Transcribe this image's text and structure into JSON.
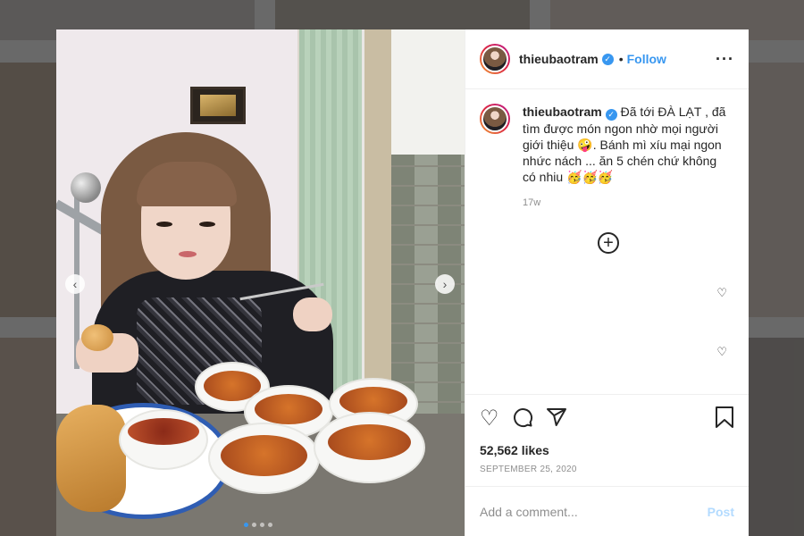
{
  "post": {
    "username": "thieubaotram",
    "verified_glyph": "✓",
    "separator": "•",
    "follow_label": "Follow",
    "more_icon": "···",
    "caption": "Đã tới ĐÀ LẠT , đã tìm được món ngon nhờ mọi người giới thiệu 🤪. Bánh mì xíu mại ngon nhức nách ... ăn 5 chén chứ không có nhiu 🥳🥳🥳",
    "time_ago": "17w",
    "load_more_icon": "+",
    "likes": "52,562 likes",
    "date": "SEPTEMBER 25, 2020",
    "comment_placeholder": "Add a comment...",
    "post_label": "Post"
  },
  "icons": {
    "heart": "heart-icon",
    "comment": "comment-bubble-icon",
    "share": "paper-plane-icon",
    "save": "bookmark-icon",
    "more": "more-options-icon",
    "prev": "chevron-left-icon",
    "next": "chevron-right-icon"
  },
  "colors": {
    "link": "#3897f0",
    "post_disabled": "#b3dbff",
    "muted": "#8e8e8e"
  },
  "carousel": {
    "prev_glyph": "‹",
    "next_glyph": "›"
  }
}
